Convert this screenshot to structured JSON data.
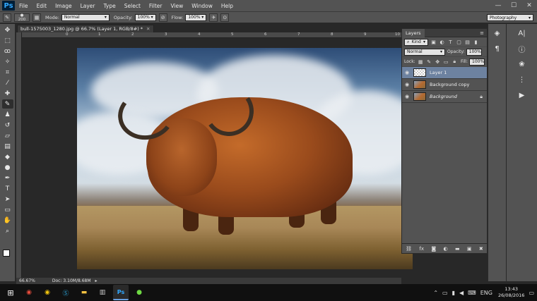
{
  "app": {
    "logo": "Ps"
  },
  "menu": [
    "File",
    "Edit",
    "Image",
    "Layer",
    "Type",
    "Select",
    "Filter",
    "View",
    "Window",
    "Help"
  ],
  "window_controls": {
    "minimize": "—",
    "maximize": "☐",
    "close": "✕"
  },
  "options_bar": {
    "brush_size": "200",
    "mode_label": "Mode:",
    "mode_value": "Normal",
    "opacity_label": "Opacity:",
    "opacity_value": "100%",
    "flow_label": "Flow:",
    "flow_value": "100%",
    "workspace": "Photography"
  },
  "document": {
    "tab_title": "bull-1575003_1280.jpg @ 66.7% (Layer 1, RGB/8#) *",
    "ruler_ticks": [
      "0",
      "1",
      "2",
      "3",
      "4",
      "5",
      "6",
      "7",
      "8",
      "9",
      "10"
    ]
  },
  "status": {
    "zoom": "66.67%",
    "doc_info": "Doc: 3.10M/8.68M"
  },
  "layers_panel": {
    "tab_label": "Layers",
    "filter_label": "Kind",
    "blend_mode": "Normal",
    "opacity_label": "Opacity:",
    "opacity_value": "100%",
    "lock_label": "Lock:",
    "fill_label": "Fill:",
    "fill_value": "100%",
    "layers": [
      {
        "name": "Layer 1",
        "selected": true,
        "thumb": "blank",
        "locked": false
      },
      {
        "name": "Background copy",
        "selected": false,
        "thumb": "photo",
        "locked": false
      },
      {
        "name": "Background",
        "selected": false,
        "thumb": "photo",
        "locked": true
      }
    ]
  },
  "taskbar": {
    "language": "ENG",
    "time": "13:43",
    "date": "26/08/2016"
  }
}
